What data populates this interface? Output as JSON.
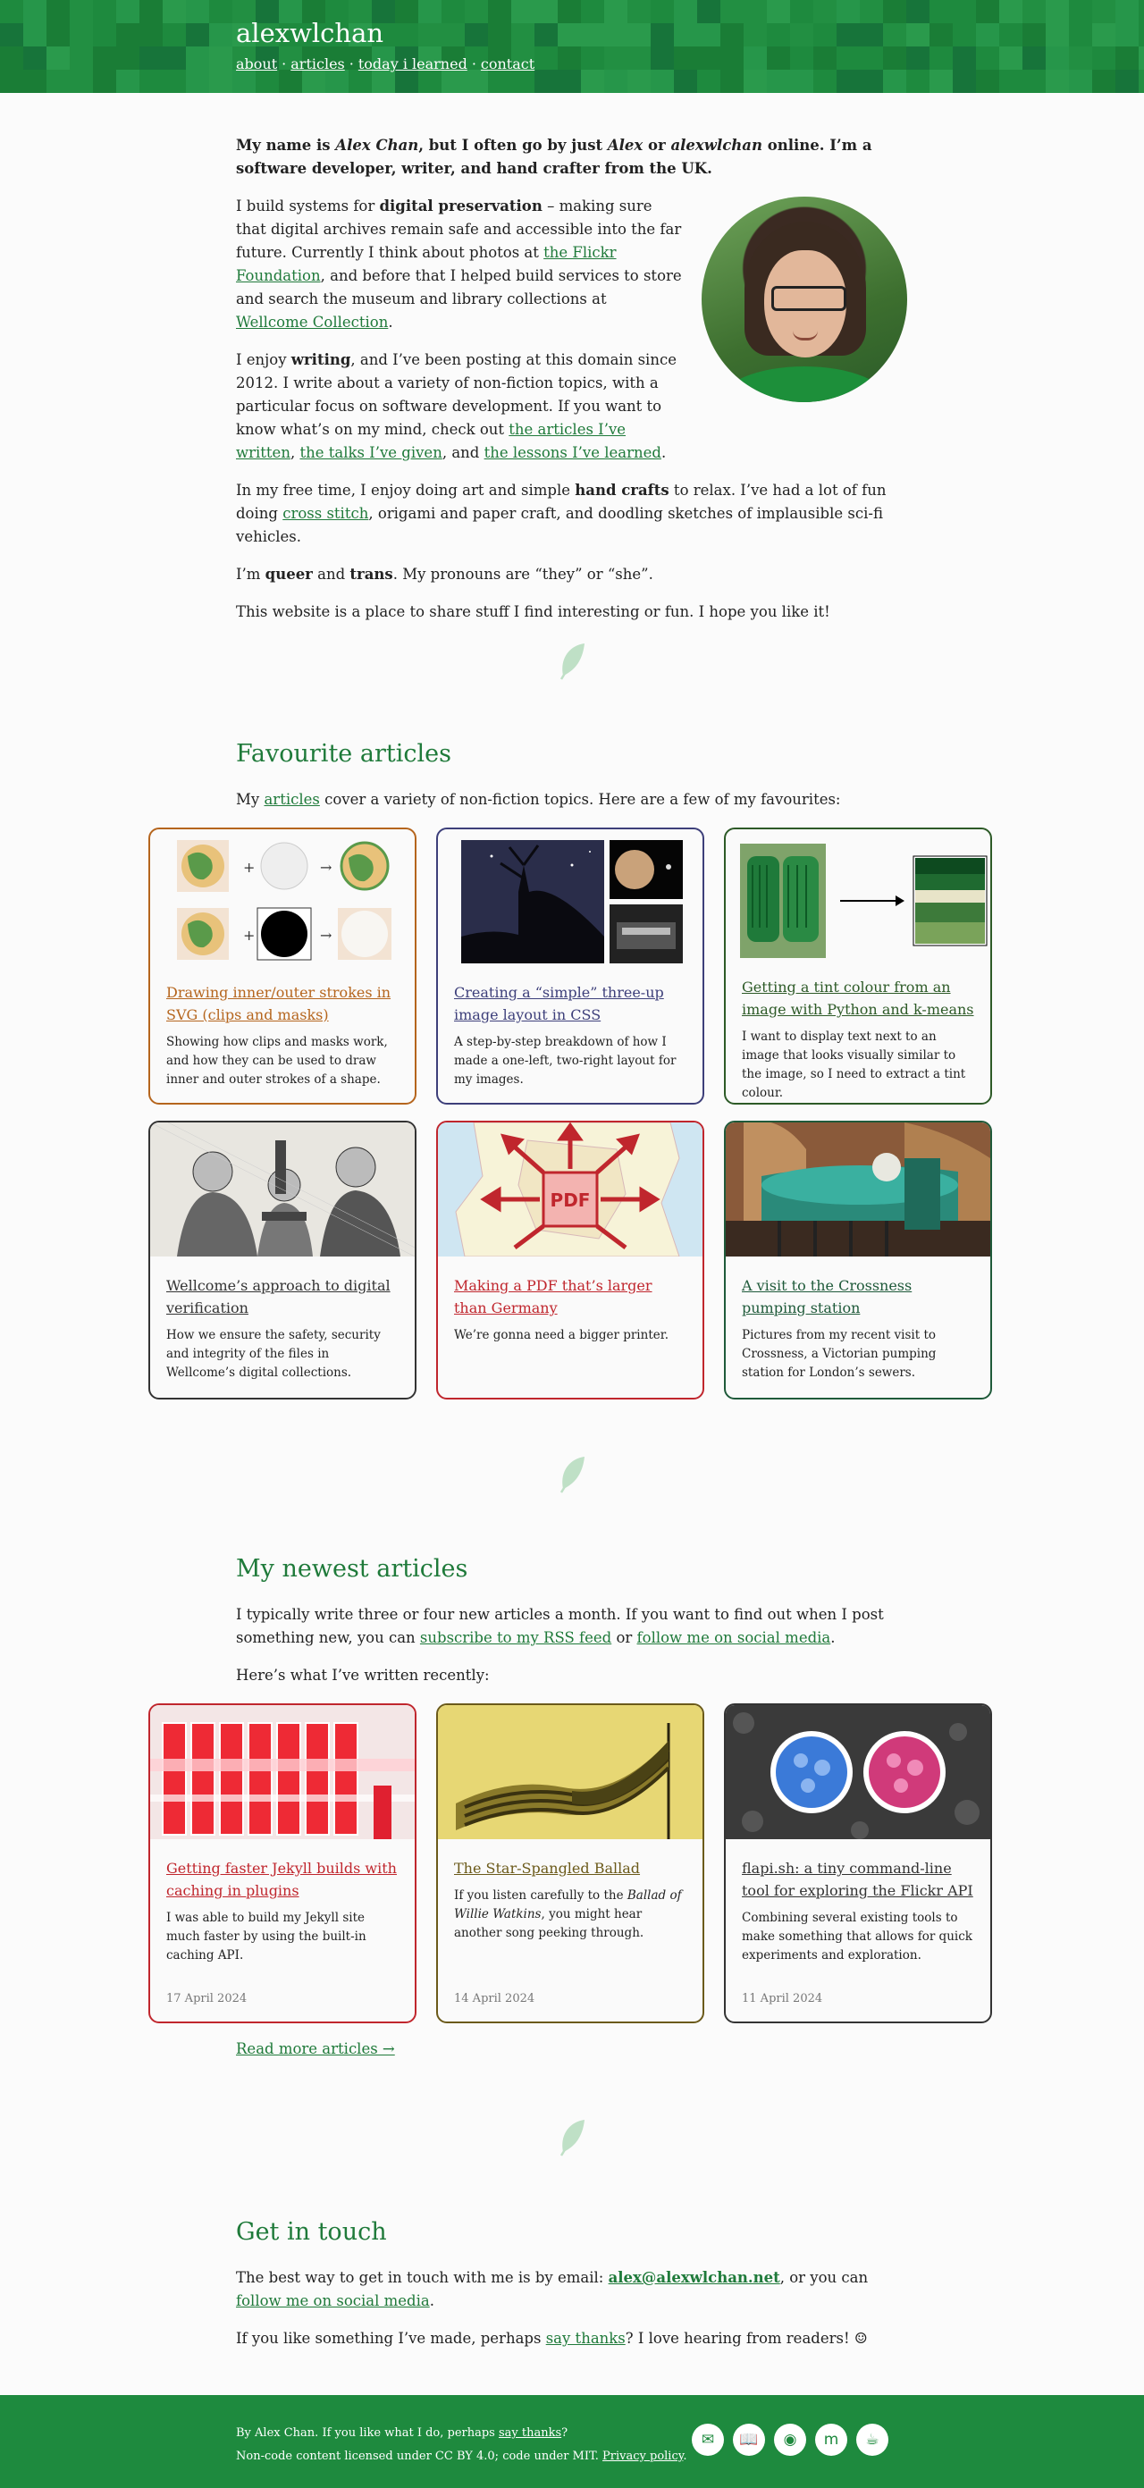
{
  "header": {
    "title": "alexwlchan",
    "nav": [
      "about",
      "articles",
      "today i learned",
      "contact"
    ]
  },
  "intro": {
    "lead_1": "My name is ",
    "lead_name": "Alex Chan",
    "lead_2": ", but I often go by just ",
    "lead_alex": "Alex",
    "lead_3": " or ",
    "lead_handle": "alexwlchan",
    "lead_4": " online. I’m a software developer, writer, and hand crafter from the UK.",
    "p1_a": "I build systems for ",
    "p1_bold": "digital preservation",
    "p1_b": " – making sure that digital archives remain safe and accessible into the far future. Currently I think about photos at ",
    "p1_link1": "the Flickr Foundation",
    "p1_c": ", and before that I helped build services to store and search the museum and library collections at ",
    "p1_link2": "Wellcome Collection",
    "p1_d": ".",
    "p2_a": "I enjoy ",
    "p2_bold": "writing",
    "p2_b": ", and I’ve been posting at this domain since 2012. I write about a variety of non-fiction topics, with a particular focus on software development. If you want to know what’s on my mind, check out ",
    "p2_link1": "the articles I’ve written",
    "p2_c": ", ",
    "p2_link2": "the talks I’ve given",
    "p2_d": ", and ",
    "p2_link3": "the lessons I’ve learned",
    "p2_e": ".",
    "p3_a": "In my free time, I enjoy doing art and simple ",
    "p3_bold": "hand crafts",
    "p3_b": " to relax. I’ve had a lot of fun doing ",
    "p3_link": "cross stitch",
    "p3_c": ", origami and paper craft, and doodling sketches of implausible sci-fi vehicles.",
    "p4_a": "I’m ",
    "p4_bold1": "queer",
    "p4_b": " and ",
    "p4_bold2": "trans",
    "p4_c": ". My pronouns are “they” or “she”.",
    "p5": "This website is a place to share stuff I find interesting or fun. I hope you like it!"
  },
  "favourites": {
    "heading": "Favourite articles",
    "intro_a": "My ",
    "intro_link": "articles",
    "intro_b": " cover a variety of non-fiction topics. Here are a few of my favourites:",
    "cards": [
      {
        "title": "Drawing inner/outer strokes in SVG (clips and masks)",
        "desc": "Showing how clips and masks work, and how they can be used to draw inner and outer strokes of a shape.",
        "color": "#b5651d"
      },
      {
        "title": "Creating a “simple” three-up image layout in CSS",
        "desc": "A step-by-step breakdown of how I made a one-left, two-right layout for my images.",
        "color": "#3d3f7a"
      },
      {
        "title": "Getting a tint colour from an image with Python and k-means",
        "desc": "I want to display text next to an image that looks visually similar to the image, so I need to extract a tint colour.",
        "color": "#2d5a27"
      },
      {
        "title": "Wellcome’s approach to digital verification",
        "desc": "How we ensure the safety, security and integrity of the files in Wellcome’s digital collections.",
        "color": "#333333"
      },
      {
        "title": "Making a PDF that’s larger than Germany",
        "desc": "We’re gonna need a bigger printer.",
        "color": "#c0262d",
        "pdf_label": "PDF"
      },
      {
        "title": "A visit to the Crossness pumping station",
        "desc": "Pictures from my recent visit to Crossness, a Victorian pumping station for London’s sewers.",
        "color": "#1f5a3a"
      }
    ]
  },
  "newest": {
    "heading": "My newest articles",
    "p1_a": "I typically write three or four new articles a month. If you want to find out when I post something new, you can ",
    "p1_link1": "subscribe to my RSS feed",
    "p1_b": " or ",
    "p1_link2": "follow me on social media",
    "p1_c": ".",
    "p2": "Here’s what I’ve written recently:",
    "cards": [
      {
        "title": "Getting faster Jekyll builds with caching in plugins",
        "desc": "I was able to build my Jekyll site much faster by using the built-in caching API.",
        "date": "17 April 2024",
        "color": "#c0262d"
      },
      {
        "title": "The Star-Spangled Ballad",
        "desc_a": "If you listen carefully to the ",
        "desc_em": "Ballad of Willie Watkins",
        "desc_b": ", you might hear another song peeking through.",
        "date": "14 April 2024",
        "color": "#6b5a1a"
      },
      {
        "title": "flapi.sh: a tiny command-line tool for exploring the Flickr API",
        "desc": "Combining several existing tools to make something that allows for quick experiments and exploration.",
        "date": "11 April 2024",
        "color": "#333333"
      }
    ],
    "more": "Read more articles →"
  },
  "contact": {
    "heading": "Get in touch",
    "p1_a": "The best way to get in touch with me is by email: ",
    "p1_email": "alex@alexwlchan.net",
    "p1_b": ", or you can ",
    "p1_link": "follow me on social media",
    "p1_c": ".",
    "p2_a": "If you like something I’ve made, perhaps ",
    "p2_link": "say thanks",
    "p2_b": "? I love hearing from readers! ☺"
  },
  "footer": {
    "line1_a": "By Alex Chan. If you like what I do, perhaps ",
    "line1_link": "say thanks",
    "line1_b": "?",
    "line2_a": "Non-code content licensed under CC BY 4.0; code under MIT. ",
    "line2_link": "Privacy policy",
    "line2_b": ".",
    "icons": [
      "email-icon",
      "book-icon",
      "rss-icon",
      "mastodon-icon",
      "kofi-icon"
    ]
  },
  "colors": {
    "brand": "#1e8a3e",
    "link": "#1f7a3a",
    "background": "#fbfbfb"
  }
}
